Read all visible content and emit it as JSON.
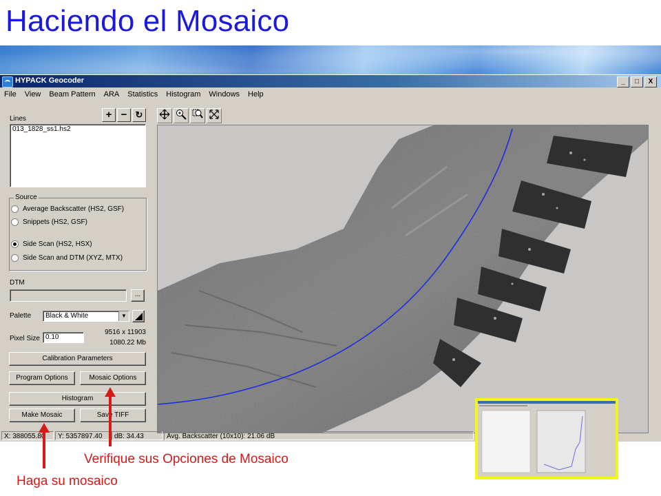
{
  "slide": {
    "title": "Haciendo el Mosaico",
    "callout_options": "Verifique sus Opciones de Mosaico",
    "callout_make": "Haga su mosaico"
  },
  "window": {
    "title": "HYPACK Geocoder",
    "buttons": [
      "_",
      "□",
      "X"
    ]
  },
  "menu": [
    "File",
    "View",
    "Beam Pattern",
    "ARA",
    "Statistics",
    "Histogram",
    "Windows",
    "Help"
  ],
  "lines": {
    "label": "Lines",
    "items": [
      "013_1828_ss1.hs2"
    ],
    "add_symbol": "+",
    "remove_symbol": "−",
    "refresh_symbol": "↻"
  },
  "source": {
    "title": "Source",
    "options": [
      {
        "label": "Average Backscatter (HS2, GSF)",
        "selected": false
      },
      {
        "label": "Snippets (HS2, GSF)",
        "selected": false
      },
      {
        "label": "Side Scan (HS2, HSX)",
        "selected": true
      },
      {
        "label": "Side Scan and DTM (XYZ, MTX)",
        "selected": false
      }
    ]
  },
  "dtm": {
    "label": "DTM",
    "browse": "..."
  },
  "palette": {
    "label": "Palette",
    "value": "Black & White"
  },
  "pixel": {
    "label": "Pixel Size",
    "value": "0.10",
    "dims": "9516 x 11903",
    "size": "1080.22 Mb"
  },
  "buttons": {
    "calibration": "Calibration Parameters",
    "program_options": "Program Options",
    "mosaic_options": "Mosaic Options",
    "histogram": "Histogram",
    "make_mosaic": "Make Mosaic",
    "save_tiff": "Save TIFF"
  },
  "status": {
    "x": "X: 388055.80",
    "y": "Y: 5357897.40",
    "db": "dB: 34.43",
    "avg": "Avg. Backscatter (10x10): 21.06 dB"
  },
  "colors": {
    "title": "#1a1ad8",
    "callout": "#d51a1a",
    "track": "#1a2ee0",
    "inset_border": "#f5f51e"
  }
}
